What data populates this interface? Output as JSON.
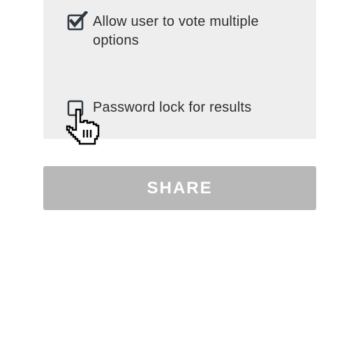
{
  "options": {
    "multiple_votes": {
      "label": "Allow user to vote multiple options",
      "checked": true
    },
    "password_lock": {
      "label": "Password lock for results",
      "checked": false
    }
  },
  "share_button": {
    "label": "SHARE",
    "disabled": true
  },
  "colors": {
    "panel_background": "#eeeeee",
    "button_background": "#b8b8b8",
    "button_text": "#ffffff",
    "label_text": "#2f2f2f",
    "checkbox_border": "#2d3840"
  },
  "icons": {
    "cursor": "hand-pointer-icon",
    "check": "checkmark-icon"
  }
}
